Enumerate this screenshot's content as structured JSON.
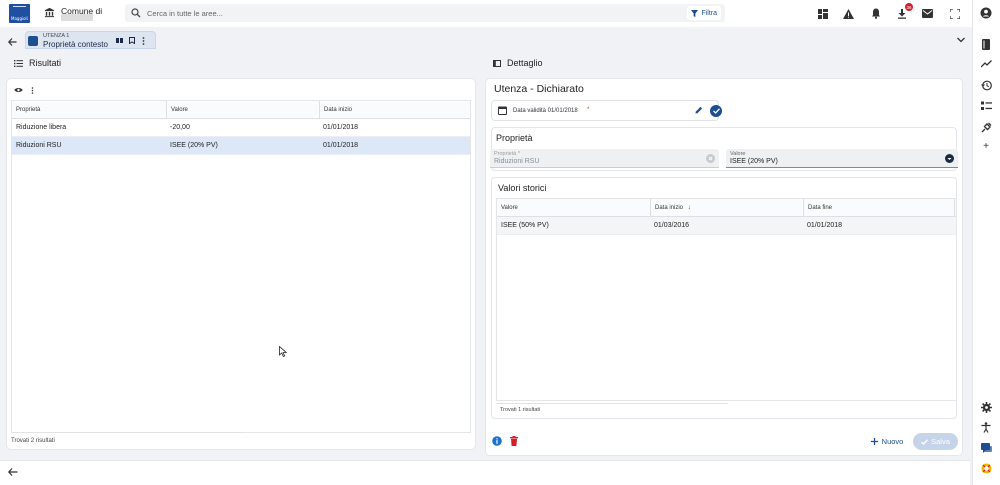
{
  "app": {
    "logo_text": "Maggioli",
    "comune_label": "Comune di"
  },
  "search": {
    "placeholder": "Cerca in tutte le aree...",
    "filter_label": "Filtra"
  },
  "notifications": {
    "downloads_badge": "36"
  },
  "tab": {
    "supertitle": "UTENZA 1",
    "title": "Proprietà contesto"
  },
  "results": {
    "header": "Risultati",
    "columns": [
      "Proprietà",
      "Valore",
      "Data inizio"
    ],
    "rows": [
      {
        "prop": "Riduzione libera",
        "value": "-20,00",
        "date": "01/01/2018"
      },
      {
        "prop": "Riduzioni RSU",
        "value": "ISEE (20% PV)",
        "date": "01/01/2018"
      }
    ],
    "footer": "Trovati 2 risultati"
  },
  "detail": {
    "header": "Dettaglio",
    "title": "Utenza - Dichiarato",
    "validity_label": "Data validità 01/01/2018",
    "required_marker": "*",
    "properties_section": "Proprietà",
    "property_field": {
      "label": "Proprietà *",
      "value": "Riduzioni RSU"
    },
    "value_field": {
      "label": "Valore",
      "value": "ISEE (20% PV)"
    },
    "history": {
      "title": "Valori storici",
      "columns": [
        "Valore",
        "Data inizio",
        "Data fine"
      ],
      "sort_indicator": "↓",
      "rows": [
        {
          "value": "ISEE (50% PV)",
          "start": "01/03/2016",
          "end": "01/01/2018"
        }
      ],
      "footer": "Trovati 1 risultati"
    },
    "new_label": "Nuovo",
    "save_label": "Salva"
  },
  "colors": {
    "primary": "#1d4e8f",
    "selected_row": "#dce8f7",
    "danger": "#d21f2a"
  }
}
